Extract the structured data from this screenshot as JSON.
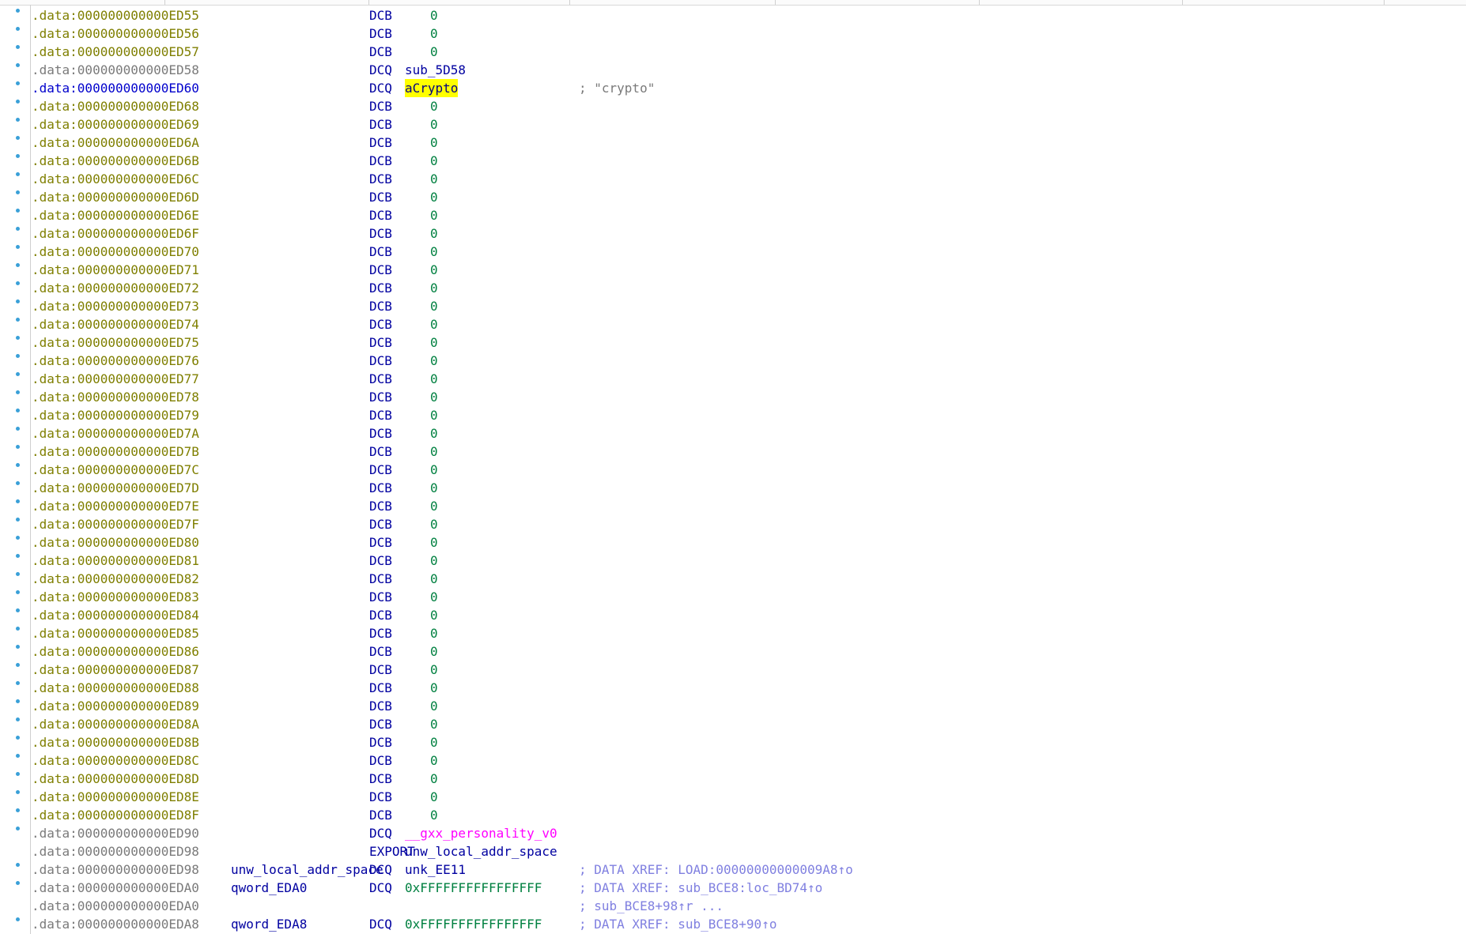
{
  "rows": [
    {
      "addr": ".data:000000000000ED55",
      "mnem": "DCB",
      "opnd": "0",
      "k": "num"
    },
    {
      "addr": ".data:000000000000ED56",
      "mnem": "DCB",
      "opnd": "0",
      "k": "num"
    },
    {
      "addr": ".data:000000000000ED57",
      "mnem": "DCB",
      "opnd": "0",
      "k": "num"
    },
    {
      "addr": ".data:000000000000ED58",
      "mnem": "DCQ",
      "opnd": "sub_5D58",
      "k": "ref",
      "plain": true
    },
    {
      "addr": ".data:000000000000ED60",
      "mnem": "DCQ",
      "opnd": "aCrypto",
      "k": "hl",
      "cmt": "; \"crypto\"",
      "ck": "str",
      "active": true
    },
    {
      "addr": ".data:000000000000ED68",
      "mnem": "DCB",
      "opnd": "0",
      "k": "num"
    },
    {
      "addr": ".data:000000000000ED69",
      "mnem": "DCB",
      "opnd": "0",
      "k": "num"
    },
    {
      "addr": ".data:000000000000ED6A",
      "mnem": "DCB",
      "opnd": "0",
      "k": "num"
    },
    {
      "addr": ".data:000000000000ED6B",
      "mnem": "DCB",
      "opnd": "0",
      "k": "num"
    },
    {
      "addr": ".data:000000000000ED6C",
      "mnem": "DCB",
      "opnd": "0",
      "k": "num"
    },
    {
      "addr": ".data:000000000000ED6D",
      "mnem": "DCB",
      "opnd": "0",
      "k": "num"
    },
    {
      "addr": ".data:000000000000ED6E",
      "mnem": "DCB",
      "opnd": "0",
      "k": "num"
    },
    {
      "addr": ".data:000000000000ED6F",
      "mnem": "DCB",
      "opnd": "0",
      "k": "num"
    },
    {
      "addr": ".data:000000000000ED70",
      "mnem": "DCB",
      "opnd": "0",
      "k": "num"
    },
    {
      "addr": ".data:000000000000ED71",
      "mnem": "DCB",
      "opnd": "0",
      "k": "num"
    },
    {
      "addr": ".data:000000000000ED72",
      "mnem": "DCB",
      "opnd": "0",
      "k": "num"
    },
    {
      "addr": ".data:000000000000ED73",
      "mnem": "DCB",
      "opnd": "0",
      "k": "num"
    },
    {
      "addr": ".data:000000000000ED74",
      "mnem": "DCB",
      "opnd": "0",
      "k": "num"
    },
    {
      "addr": ".data:000000000000ED75",
      "mnem": "DCB",
      "opnd": "0",
      "k": "num"
    },
    {
      "addr": ".data:000000000000ED76",
      "mnem": "DCB",
      "opnd": "0",
      "k": "num"
    },
    {
      "addr": ".data:000000000000ED77",
      "mnem": "DCB",
      "opnd": "0",
      "k": "num"
    },
    {
      "addr": ".data:000000000000ED78",
      "mnem": "DCB",
      "opnd": "0",
      "k": "num"
    },
    {
      "addr": ".data:000000000000ED79",
      "mnem": "DCB",
      "opnd": "0",
      "k": "num"
    },
    {
      "addr": ".data:000000000000ED7A",
      "mnem": "DCB",
      "opnd": "0",
      "k": "num"
    },
    {
      "addr": ".data:000000000000ED7B",
      "mnem": "DCB",
      "opnd": "0",
      "k": "num"
    },
    {
      "addr": ".data:000000000000ED7C",
      "mnem": "DCB",
      "opnd": "0",
      "k": "num"
    },
    {
      "addr": ".data:000000000000ED7D",
      "mnem": "DCB",
      "opnd": "0",
      "k": "num"
    },
    {
      "addr": ".data:000000000000ED7E",
      "mnem": "DCB",
      "opnd": "0",
      "k": "num"
    },
    {
      "addr": ".data:000000000000ED7F",
      "mnem": "DCB",
      "opnd": "0",
      "k": "num"
    },
    {
      "addr": ".data:000000000000ED80",
      "mnem": "DCB",
      "opnd": "0",
      "k": "num"
    },
    {
      "addr": ".data:000000000000ED81",
      "mnem": "DCB",
      "opnd": "0",
      "k": "num"
    },
    {
      "addr": ".data:000000000000ED82",
      "mnem": "DCB",
      "opnd": "0",
      "k": "num"
    },
    {
      "addr": ".data:000000000000ED83",
      "mnem": "DCB",
      "opnd": "0",
      "k": "num"
    },
    {
      "addr": ".data:000000000000ED84",
      "mnem": "DCB",
      "opnd": "0",
      "k": "num"
    },
    {
      "addr": ".data:000000000000ED85",
      "mnem": "DCB",
      "opnd": "0",
      "k": "num"
    },
    {
      "addr": ".data:000000000000ED86",
      "mnem": "DCB",
      "opnd": "0",
      "k": "num"
    },
    {
      "addr": ".data:000000000000ED87",
      "mnem": "DCB",
      "opnd": "0",
      "k": "num"
    },
    {
      "addr": ".data:000000000000ED88",
      "mnem": "DCB",
      "opnd": "0",
      "k": "num"
    },
    {
      "addr": ".data:000000000000ED89",
      "mnem": "DCB",
      "opnd": "0",
      "k": "num"
    },
    {
      "addr": ".data:000000000000ED8A",
      "mnem": "DCB",
      "opnd": "0",
      "k": "num"
    },
    {
      "addr": ".data:000000000000ED8B",
      "mnem": "DCB",
      "opnd": "0",
      "k": "num"
    },
    {
      "addr": ".data:000000000000ED8C",
      "mnem": "DCB",
      "opnd": "0",
      "k": "num"
    },
    {
      "addr": ".data:000000000000ED8D",
      "mnem": "DCB",
      "opnd": "0",
      "k": "num"
    },
    {
      "addr": ".data:000000000000ED8E",
      "mnem": "DCB",
      "opnd": "0",
      "k": "num"
    },
    {
      "addr": ".data:000000000000ED8F",
      "mnem": "DCB",
      "opnd": "0",
      "k": "num"
    },
    {
      "addr": ".data:000000000000ED90",
      "mnem": "DCQ",
      "opnd": "__gxx_personality_v0",
      "k": "imp",
      "plain": true
    },
    {
      "addr": ".data:000000000000ED98",
      "mnem": "EXPORT",
      "opnd": "unw_local_addr_space",
      "k": "ref",
      "plain": true,
      "nobullet": true
    },
    {
      "addr": ".data:000000000000ED98",
      "label": "unw_local_addr_space",
      "mnem": "DCQ",
      "opnd": "unk_EE11",
      "k": "ref",
      "cmt": "; DATA XREF: LOAD:00000000000009A8↑o",
      "plain": true
    },
    {
      "addr": ".data:000000000000EDA0",
      "label": "qword_EDA0",
      "mnem": "DCQ",
      "opnd": "0xFFFFFFFFFFFFFFFF",
      "k": "hex",
      "cmt": "; DATA XREF: sub_BCE8:loc_BD74↑o",
      "plain": true
    },
    {
      "addr": ".data:000000000000EDA0",
      "cmt": "; sub_BCE8+98↑r ...",
      "plain": true,
      "nobullet": true
    },
    {
      "addr": ".data:000000000000EDA8",
      "label": "qword_EDA8",
      "mnem": "DCQ",
      "opnd": "0xFFFFFFFFFFFFFFFF",
      "k": "hex",
      "cmt": "; DATA XREF: sub_BCE8+90↑o",
      "plain": true
    }
  ]
}
